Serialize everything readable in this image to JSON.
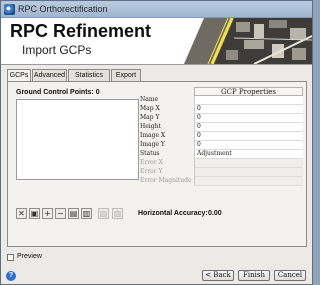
{
  "window": {
    "title": "RPC Orthorectification"
  },
  "header": {
    "title": "RPC Refinement",
    "subtitle": "Import GCPs"
  },
  "tabs": [
    {
      "label": "GCPs",
      "active": true
    },
    {
      "label": "Advanced",
      "active": false
    },
    {
      "label": "Statistics",
      "active": false
    },
    {
      "label": "Export",
      "active": false
    }
  ],
  "gcp_panel": {
    "label": "Ground Control Points: 0",
    "properties_header": "GCP Properties",
    "properties": [
      {
        "name": "Name",
        "value": "",
        "enabled": true
      },
      {
        "name": "Map X",
        "value": "0",
        "enabled": true
      },
      {
        "name": "Map Y",
        "value": "0",
        "enabled": true
      },
      {
        "name": "Height",
        "value": "0",
        "enabled": true
      },
      {
        "name": "Image X",
        "value": "0",
        "enabled": true
      },
      {
        "name": "Image Y",
        "value": "0",
        "enabled": true
      },
      {
        "name": "Status",
        "value": "Adjustment",
        "enabled": true
      },
      {
        "name": "Error X",
        "value": "",
        "enabled": false
      },
      {
        "name": "Error Y",
        "value": "",
        "enabled": false
      },
      {
        "name": "Error Magnitude",
        "value": "",
        "enabled": false
      }
    ],
    "toolbar_icons": [
      "delete-icon",
      "copy-icon",
      "add-icon",
      "remove-icon",
      "open-icon",
      "save-icon",
      "export-icon",
      "reset-icon"
    ],
    "horizontal_accuracy_label": "Horizontal Accuracy:",
    "horizontal_accuracy_value": "0.00"
  },
  "preview": {
    "label": "Preview",
    "checked": false
  },
  "buttons": {
    "back": "< Back",
    "finish": "Finish",
    "cancel": "Cancel"
  },
  "colors": {
    "title_bar": "#9fb5cf",
    "help": "#2d6fd0"
  }
}
